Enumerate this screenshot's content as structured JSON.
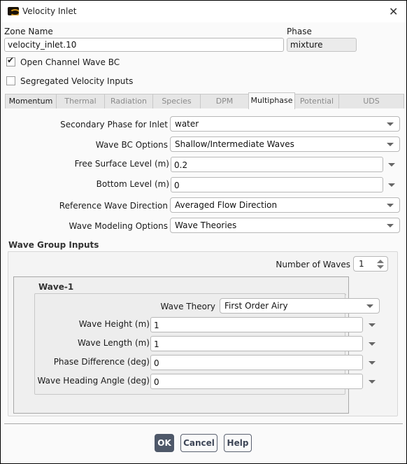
{
  "window": {
    "title": "Velocity Inlet"
  },
  "zone": {
    "zone_name_label": "Zone Name",
    "zone_name_value": "velocity_inlet.10",
    "phase_label": "Phase",
    "phase_value": "mixture"
  },
  "options": {
    "open_channel": {
      "label": "Open Channel Wave BC",
      "checked": true
    },
    "segregated": {
      "label": "Segregated Velocity Inputs",
      "checked": false
    }
  },
  "tabs": [
    {
      "label": "Momentum",
      "enabled": true,
      "active": false
    },
    {
      "label": "Thermal",
      "enabled": false,
      "active": false
    },
    {
      "label": "Radiation",
      "enabled": false,
      "active": false
    },
    {
      "label": "Species",
      "enabled": false,
      "active": false
    },
    {
      "label": "DPM",
      "enabled": false,
      "active": false
    },
    {
      "label": "Multiphase",
      "enabled": true,
      "active": true
    },
    {
      "label": "Potential",
      "enabled": false,
      "active": false
    },
    {
      "label": "UDS",
      "enabled": false,
      "active": false
    }
  ],
  "multiphase": {
    "secondary_phase": {
      "label": "Secondary Phase for Inlet",
      "value": "water"
    },
    "wave_bc": {
      "label": "Wave BC Options",
      "value": "Shallow/Intermediate Waves"
    },
    "free_surface": {
      "label": "Free Surface Level (m)",
      "value": "0.2"
    },
    "bottom_level": {
      "label": "Bottom Level (m)",
      "value": "0"
    },
    "ref_direction": {
      "label": "Reference Wave Direction",
      "value": "Averaged Flow Direction"
    },
    "modeling": {
      "label": "Wave Modeling Options",
      "value": "Wave Theories"
    }
  },
  "wave_group": {
    "title": "Wave Group Inputs",
    "num_waves_label": "Number of Waves",
    "num_waves_value": "1",
    "wave1": {
      "title": "Wave-1",
      "theory": {
        "label": "Wave Theory",
        "value": "First Order Airy"
      },
      "height": {
        "label": "Wave Height (m)",
        "value": "1"
      },
      "length": {
        "label": "Wave Length (m)",
        "value": "1"
      },
      "phase_diff": {
        "label": "Phase Difference (deg)",
        "value": "0"
      },
      "heading": {
        "label": "Wave Heading Angle (deg)",
        "value": "0"
      }
    }
  },
  "buttons": {
    "ok": "OK",
    "cancel": "Cancel",
    "help": "Help"
  }
}
